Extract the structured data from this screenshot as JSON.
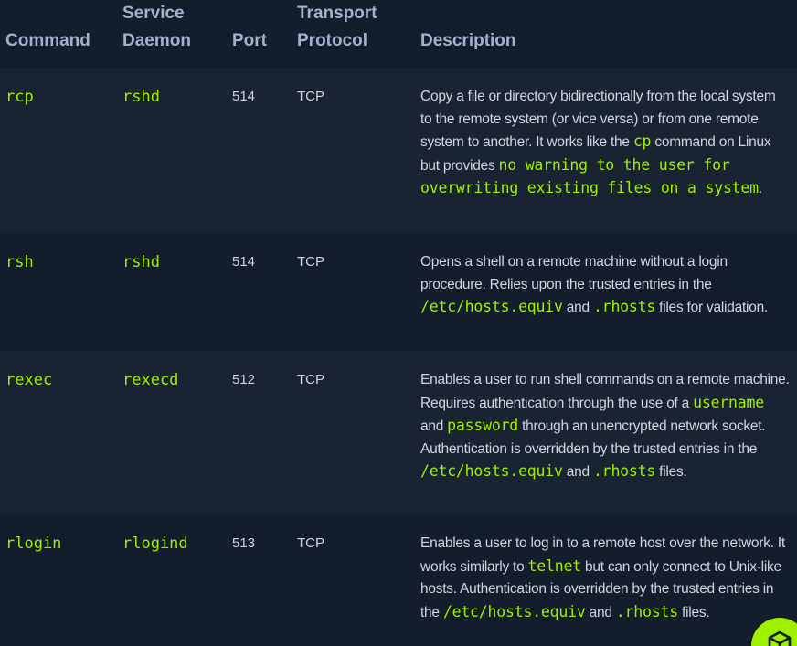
{
  "table": {
    "headers": {
      "command": "Command",
      "daemon_line1": "Service",
      "daemon_line2": "Daemon",
      "port": "Port",
      "protocol_line1": "Transport",
      "protocol_line2": "Protocol",
      "description": "Description"
    },
    "rows": [
      {
        "command": "rcp",
        "daemon": "rshd",
        "port": "514",
        "protocol": "TCP",
        "desc": [
          "Copy a file or directory bidirectionally from the local system to the remote system (or vice versa) or from one remote system to another. It works like the ",
          "cp",
          " command on Linux but provides ",
          "no warning to the user for overwriting existing files on a system",
          "."
        ]
      },
      {
        "command": "rsh",
        "daemon": "rshd",
        "port": "514",
        "protocol": "TCP",
        "desc": [
          "Opens a shell on a remote machine without a login procedure. Relies upon the trusted entries in the ",
          "/etc/hosts.equiv",
          " and ",
          ".rhosts",
          " files for validation."
        ]
      },
      {
        "command": "rexec",
        "daemon": "rexecd",
        "port": "512",
        "protocol": "TCP",
        "desc": [
          "Enables a user to run shell commands on a remote machine. Requires authentication through the use of a ",
          "username",
          " and ",
          "password",
          " through an unencrypted network socket. Authentication is overridden by the trusted entries in the ",
          "/etc/hosts.equiv",
          " and ",
          ".rhosts",
          " files."
        ]
      },
      {
        "command": "rlogin",
        "daemon": "rlogind",
        "port": "513",
        "protocol": "TCP",
        "desc": [
          "Enables a user to log in to a remote host over the network. It works similarly to ",
          "telnet",
          " but can only connect to Unix-like hosts. Authentication is overridden by the trusted entries in the ",
          "/etc/hosts.equiv",
          " and ",
          ".rhosts",
          " files."
        ]
      }
    ]
  },
  "fab": {
    "icon": "cube-icon",
    "color": "#9fef00"
  },
  "colors": {
    "background": "#141d2b",
    "row_alt": "#1a2332",
    "accent": "#9fef00",
    "header_text": "#a4b1cd",
    "body_text": "#cfd5de"
  }
}
